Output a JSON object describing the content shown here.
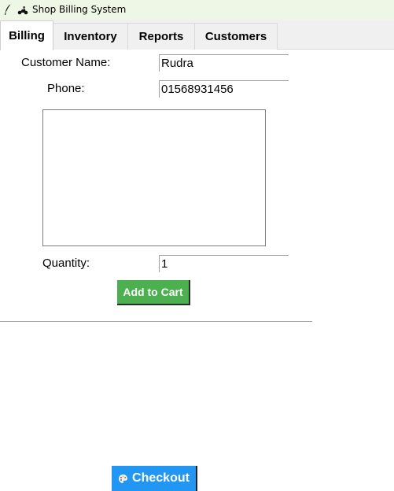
{
  "window": {
    "title": "Shop Billing System",
    "app_icon": "feather-icon",
    "title_icon": "scooter-icon"
  },
  "tabs": [
    {
      "label": "Billing",
      "active": true
    },
    {
      "label": "Inventory",
      "active": false
    },
    {
      "label": "Reports",
      "active": false
    },
    {
      "label": "Customers",
      "active": false
    }
  ],
  "billing": {
    "customer_name_label": "Customer Name:",
    "customer_name_value": "Rudra",
    "phone_label": "Phone:",
    "phone_value": "01568931456",
    "product_list": [],
    "quantity_label": "Quantity:",
    "quantity_value": "1",
    "add_to_cart_label": "Add to Cart",
    "checkout_label": "Checkout",
    "checkout_icon": "palette-icon"
  },
  "colors": {
    "add_to_cart_bg": "#4caf50",
    "checkout_bg": "#2196f3",
    "titlebar_bg": "#eef6e6"
  }
}
